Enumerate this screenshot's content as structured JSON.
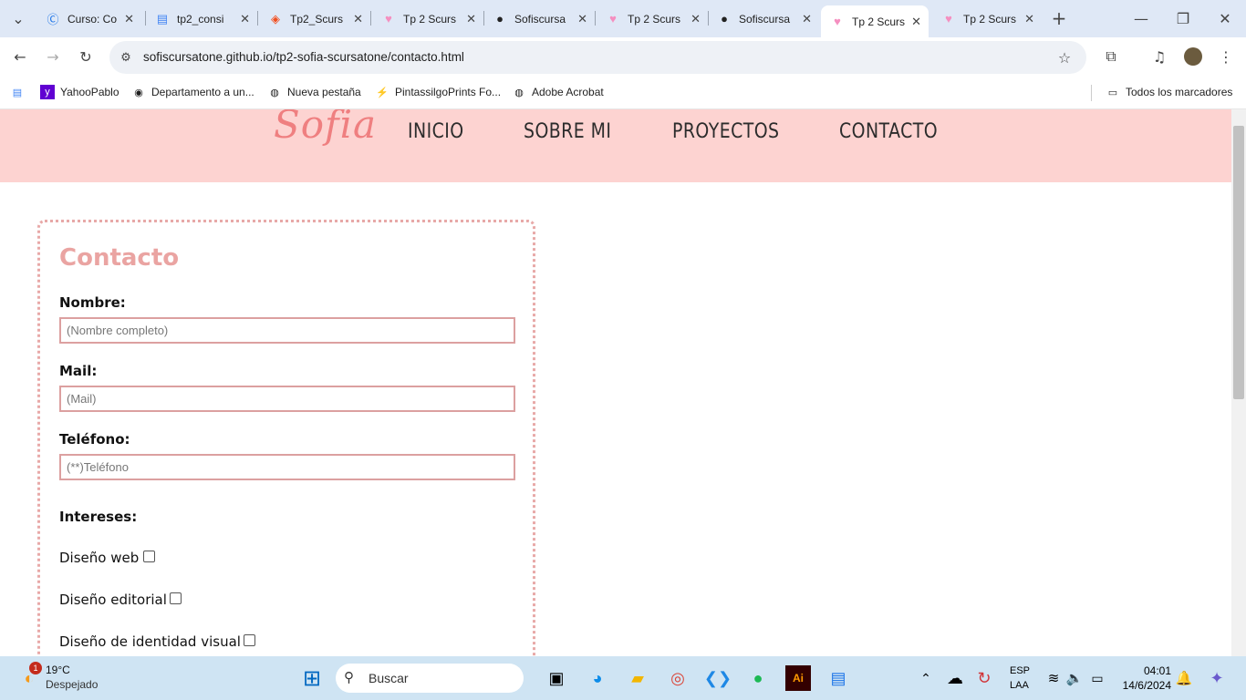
{
  "browser": {
    "tabs": [
      {
        "title": "Curso: Co",
        "icon": "course-icon"
      },
      {
        "title": "tp2_consi",
        "icon": "docs-icon"
      },
      {
        "title": "Tp2_Scurs",
        "icon": "figma-icon"
      },
      {
        "title": "Tp 2 Scurs",
        "icon": "heart-icon"
      },
      {
        "title": "Sofiscursa",
        "icon": "github-icon"
      },
      {
        "title": "Tp 2 Scurs",
        "icon": "heart-icon"
      },
      {
        "title": "Sofiscursa",
        "icon": "github-icon"
      },
      {
        "title": "Tp 2 Scurs",
        "icon": "heart-icon"
      },
      {
        "title": "Tp 2 Scurs",
        "icon": "heart-icon"
      }
    ],
    "url": "sofiscursatone.github.io/tp2-sofia-scursatone/contacto.html",
    "bookmarks": [
      "YahooPablo",
      "Departamento a un...",
      "Nueva pestaña",
      "PintassilgoPrints Fo...",
      "Adobe Acrobat"
    ],
    "all_bookmarks": "Todos los marcadores"
  },
  "site": {
    "logo": "Sofia",
    "nav": [
      "INICIO",
      "SOBRE MI",
      "PROYECTOS",
      "CONTACTO"
    ]
  },
  "form": {
    "title": "Contacto",
    "name_label": "Nombre:",
    "name_placeholder": "(Nombre completo)",
    "mail_label": "Mail:",
    "mail_placeholder": "(Mail)",
    "phone_label": "Teléfono:",
    "phone_placeholder": "(**)Teléfono",
    "interests_label": "Intereses:",
    "interests": [
      "Diseño web",
      "Diseño editorial",
      "Diseño de identidad visual"
    ]
  },
  "taskbar": {
    "weather_temp": "19°C",
    "weather_desc": "Despejado",
    "weather_badge": "1",
    "search_placeholder": "Buscar",
    "lang_top": "ESP",
    "lang_bottom": "LAA",
    "time": "04:01",
    "date": "14/6/2024"
  },
  "colors": {
    "header_bg": "#fdd3d1",
    "accent": "#ef7f80",
    "border": "#e8a9a8",
    "taskbar": "#cfe4f3"
  }
}
